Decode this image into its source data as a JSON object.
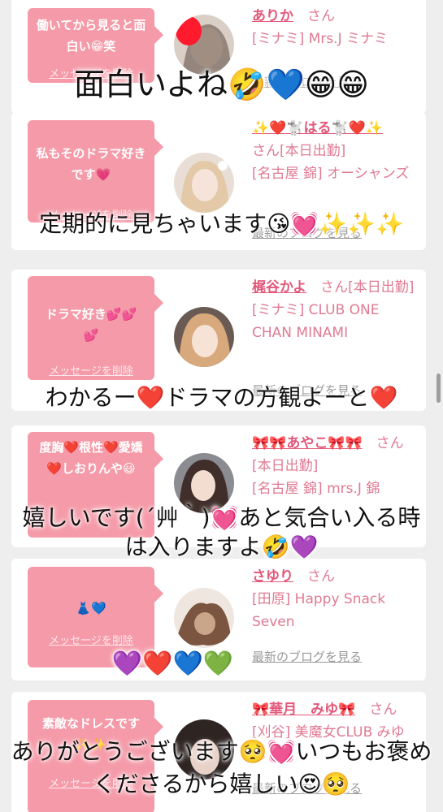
{
  "cards": [
    {
      "message": "働いてから見ると面白い😁笑",
      "delete_label": "メッセージを削除",
      "name": "ありか",
      "honorific": "さん",
      "shop": "[ミナミ] Mrs.J ミナミ",
      "blog_label": "最新のブログを見る",
      "caption": "面白いよね🤣💙😁😁"
    },
    {
      "message": "私もそのドラマ好きです💗",
      "delete_label": "メッセージを削除",
      "name": "✨❤️🐩はる🐩❤️✨",
      "honorific": "さん[本日出勤]",
      "shop": "[名古屋 錦] オーシャンズ",
      "blog_label": "最新のブログを見る",
      "caption": "定期的に見ちゃいます😘💓✨✨✨"
    },
    {
      "message": "ドラマ好き💕💕💕",
      "delete_label": "メッセージを削除",
      "name": "梶谷かよ",
      "honorific": "さん[本日出勤]",
      "shop": "[ミナミ] CLUB ONE CHAN MINAMI",
      "blog_label": "最新のブログを見る",
      "caption": "わかるー❤️ドラマの方観よーと❤️"
    },
    {
      "message": "度胸❤️根性❤️愛嬌❤️しおりんや😃",
      "delete_label": "メッセージを削除",
      "name": "🎀🎀あやこ🎀🎀",
      "honorific": "さん[本日出勤]",
      "shop": "[名古屋 錦] mrs.J 錦",
      "blog_label": "最新のブログを見る",
      "caption": "嬉しいです(´艸｀)💓あと気合い入る時は入りますよ🤣💜"
    },
    {
      "message": "👗💙",
      "delete_label": "メッセージを削除",
      "name": "さゆり",
      "honorific": "さん",
      "shop": "[田原] Happy Snack Seven",
      "blog_label": "最新のブログを見る",
      "caption": "💜❤️💙💚"
    },
    {
      "message": "素敵なドレスです✨✨",
      "delete_label": "メッセージを削除",
      "name": "🎀華月　みゆ🎀",
      "honorific": "さん",
      "shop": "[刈谷] 美魔女CLUB みゆん",
      "blog_label": "最新のブログを見る",
      "caption": "ありがとうございます🥺💓いつもお褒めくださるから嬉しい😍🥺"
    }
  ],
  "colors": {
    "bubble": "#f59aa8",
    "accent": "#e3587a",
    "background": "#eeeeee"
  }
}
